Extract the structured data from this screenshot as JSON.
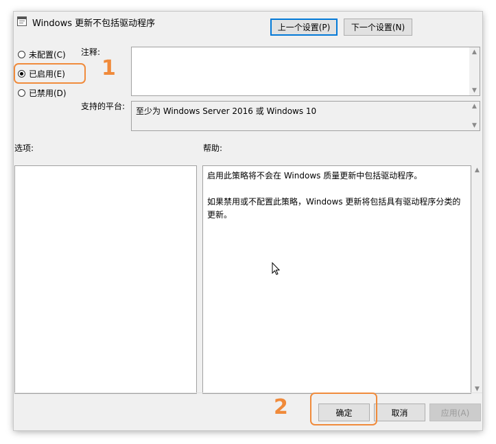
{
  "window": {
    "title": "Windows 更新不包括驱动程序"
  },
  "nav": {
    "prev_label": "上一个设置(P)",
    "next_label": "下一个设置(N)"
  },
  "state": {
    "options": [
      {
        "label": "未配置(C)",
        "checked": false
      },
      {
        "label": "已启用(E)",
        "checked": true
      },
      {
        "label": "已禁用(D)",
        "checked": false
      }
    ]
  },
  "comment": {
    "label": "注释:",
    "value": ""
  },
  "platform": {
    "label": "支持的平台:",
    "value": "至少为 Windows Server 2016 或 Windows 10"
  },
  "sections": {
    "options_label": "选项:",
    "help_label": "帮助:"
  },
  "help": {
    "paragraphs": [
      "启用此策略将不会在 Windows 质量更新中包括驱动程序。",
      "如果禁用或不配置此策略，Windows 更新将包括具有驱动程序分类的更新。"
    ]
  },
  "footer": {
    "ok_label": "确定",
    "cancel_label": "取消",
    "apply_label": "应用(A)"
  },
  "annotations": {
    "step1": "1",
    "step2": "2",
    "color": "#f08a3a"
  },
  "colors": {
    "accent": "#0078d7",
    "window_bg": "#f0f0f0"
  }
}
